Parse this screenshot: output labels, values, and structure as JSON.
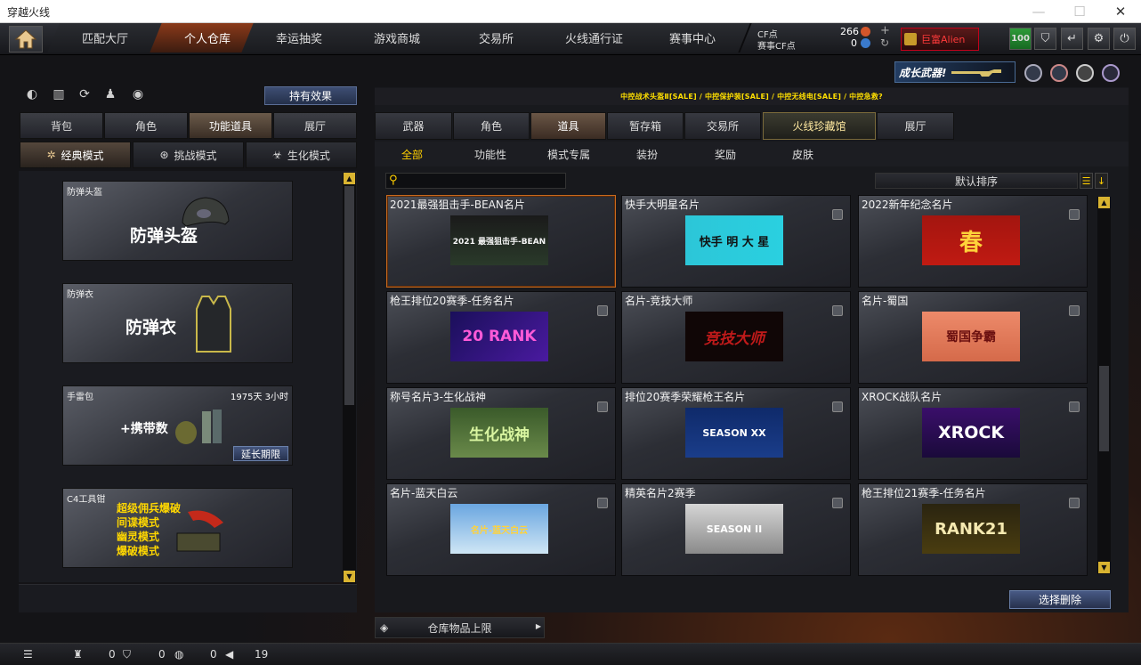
{
  "window": {
    "title": "穿越火线",
    "minimize": "—",
    "maximize": "☐",
    "close": "✕"
  },
  "nav": {
    "tabs": [
      "匹配大厅",
      "个人仓库",
      "幸运抽奖",
      "游戏商城",
      "交易所",
      "火线通行证",
      "赛事中心"
    ],
    "active": 1
  },
  "currency": {
    "cf_label": "CF点",
    "cf_value": "266",
    "match_label": "赛事CF点",
    "match_value": "0"
  },
  "player": {
    "name": "巨富Alien"
  },
  "level": "100",
  "growth": {
    "label": "成长武器!"
  },
  "left": {
    "effect_button": "持有效果",
    "tabs": [
      "背包",
      "角色",
      "功能道具",
      "展厅"
    ],
    "active_tab": 2,
    "modes": [
      "经典模式",
      "挑战模式",
      "生化模式"
    ],
    "active_mode": 0,
    "items": [
      {
        "label": "防弹头盔",
        "big": "防弹头盔"
      },
      {
        "label": "防弹衣",
        "big": "防弹衣"
      },
      {
        "label": "手雷包",
        "big": "+携带数",
        "duration": "1975天 3小时",
        "extend": "延长期限"
      },
      {
        "label": "C4工具钳",
        "list": [
          "超级佣兵爆破",
          "间谍模式",
          "幽灵模式",
          "爆破模式"
        ]
      }
    ]
  },
  "right": {
    "banner": "中控战术头盔Ⅱ[SALE] / 中控保护装[SALE] / 中控无线电[SALE] / 中控急救?",
    "tabs": [
      "武器",
      "角色",
      "道具",
      "暂存箱",
      "交易所",
      "火线珍藏馆",
      "展厅"
    ],
    "active_tab": 2,
    "subtabs": [
      "全部",
      "功能性",
      "模式专属",
      "装扮",
      "奖励",
      "皮肤"
    ],
    "active_subtab": 0,
    "sort_label": "默认排序",
    "cards": [
      {
        "title": "2021最强狙击手-BEAN名片",
        "img": "2021 最强狙击手-BEAN"
      },
      {
        "title": "快手大明星名片",
        "img": "快手 明 大 星"
      },
      {
        "title": "2022新年纪念名片",
        "img": "春"
      },
      {
        "title": "枪王排位20赛季-任务名片",
        "img": "20 RANK"
      },
      {
        "title": "名片-竞技大师",
        "img": "竞技大师"
      },
      {
        "title": "名片-蜀国",
        "img": "蜀国争霸"
      },
      {
        "title": "称号名片3-生化战神",
        "img": "生化战神"
      },
      {
        "title": "排位20赛季荣耀枪王名片",
        "img": "SEASON XX"
      },
      {
        "title": "XROCK战队名片",
        "img": "XROCK"
      },
      {
        "title": "名片-蓝天白云",
        "img": "名片-蓝天白云"
      },
      {
        "title": "精英名片2赛季",
        "img": "SEASON II"
      },
      {
        "title": "枪王排位21赛季-任务名片",
        "img": "RANK21"
      }
    ],
    "delete_button": "选择删除",
    "capacity": "仓库物品上限"
  },
  "status": {
    "v1": "0",
    "v2": "0",
    "v3": "0",
    "v4": "19"
  }
}
